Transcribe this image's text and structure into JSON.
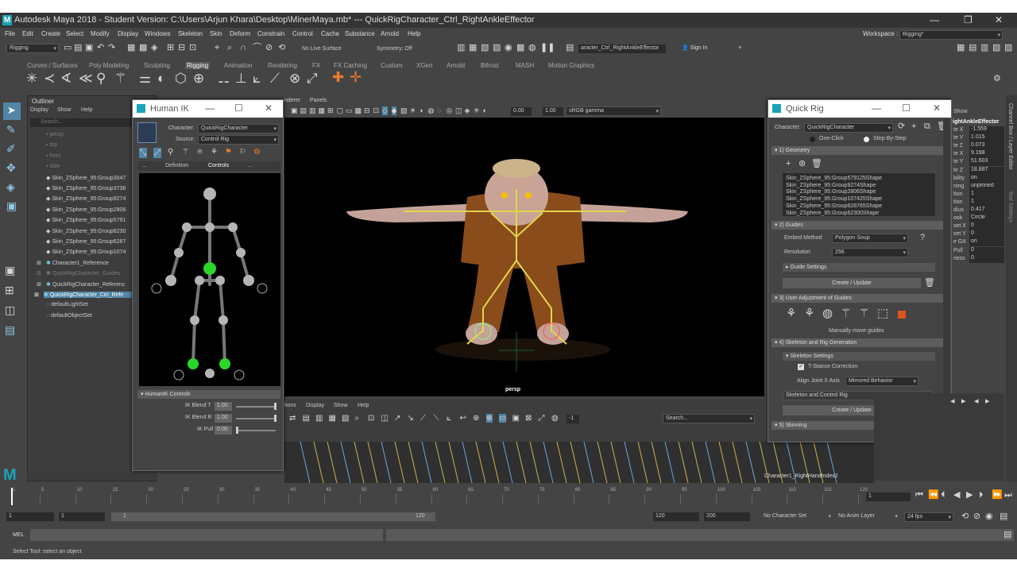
{
  "title": "Autodesk Maya 2018 - Student Version: C:\\Users\\Arjun Khara\\Desktop\\MinerMaya.mb*  ---  QuickRigCharacter_Ctrl_RightAnkleEffector",
  "menu": [
    "File",
    "Edit",
    "Create",
    "Select",
    "Modify",
    "Display",
    "Windows",
    "Skeleton",
    "Skin",
    "Deform",
    "Constrain",
    "Control",
    "Cache",
    "Substance",
    "Arnold",
    "Help"
  ],
  "workspace_label": "Workspace :",
  "workspace_value": "Rigging*",
  "mode_select": "Rigging",
  "live_surface": "No Live Surface",
  "symmetry": "Symmetry: Off",
  "selected_field": "aracter_Ctrl_RightAnkleEffector",
  "sign_in": "Sign In",
  "shelf_tabs": [
    "Curves / Surfaces",
    "Poly Modeling",
    "Sculpting",
    "Rigging",
    "Animation",
    "Rendering",
    "FX",
    "FX Caching",
    "Custom",
    "XGen",
    "Arnold",
    "Bifrost",
    "MASH",
    "Motion Graphics"
  ],
  "outliner": {
    "title": "Outliner",
    "menu": [
      "Display",
      "Show",
      "Help"
    ],
    "search_placeholder": "Search...",
    "items": [
      "persp",
      "top",
      "front",
      "side",
      "Skin_ZSphere_95:Group3047",
      "Skin_ZSphere_95:Group3736",
      "Skin_ZSphere_95:Group9274",
      "Skin_ZSphere_95:Group2806",
      "Skin_ZSphere_95:Group5791",
      "Skin_ZSphere_95:Group6230",
      "Skin_ZSphere_95:Group6287",
      "Skin_ZSphere_95:Group1074",
      "Character1_Reference",
      "QuickRigCharacter_Guides",
      "QuickRigCharacter_Referenc",
      "QuickRigCharacter_Ctrl_Refe",
      "defaultLightSet",
      "defaultObjectSet"
    ]
  },
  "humanik": {
    "title": "Human IK",
    "character_label": "Character:",
    "character": "QuickRigCharacter",
    "source_label": "Source:",
    "source": "Control Rig",
    "tabs": [
      "Definition",
      "Controls"
    ],
    "tab_dots": "...",
    "controls_header": "HumanIK Controls",
    "blend_t_label": "IK Blend T",
    "blend_t": "1.00",
    "blend_r_label": "IK Blend R",
    "blend_r": "1.00",
    "pull_label": "IK Pull",
    "pull": "0.00"
  },
  "viewport": {
    "menu_tail": "nderer",
    "panels": "Panels",
    "field1": "0.00",
    "field2": "1.00",
    "color_space": "sRGB gamma",
    "camera": "persp"
  },
  "graph_menu": [
    "tions",
    "Display",
    "Show",
    "Help"
  ],
  "graph_search": "Search...",
  "graph_field": "-1",
  "quickrig": {
    "title": "Quick Rig",
    "character_label": "Character:",
    "character": "QuickRigCharacter",
    "one_click": "One-Click",
    "step_by_step": "Step-By-Step",
    "geometry": "1) Geometry",
    "geo_list": [
      "Skin_ZSphere_95:Group579125Shape",
      "Skin_ZSphere_95:Group9274Shape",
      "Skin_ZSphere_95:Group2806Shape",
      "Skin_ZSphere_95:Group107425Shape",
      "Skin_ZSphere_95:Group628765Shape",
      "Skin_ZSphere_95:Group62300Shape"
    ],
    "guides": "2) Guides",
    "embed_label": "Embed Method",
    "embed": "Polygon Soup",
    "resolution_label": "Resolution",
    "resolution": "256",
    "guide_settings": "Guide Settings",
    "create_update": "Create / Update",
    "user_adjust": "3) User Adjustment of Guides",
    "manually": "Manually move guides",
    "skeleton_rig": "4) Skeleton and Rig Generation",
    "skeleton_settings": "Skeleton Settings",
    "tstance": "T-Stance Correction",
    "align_label": "Align Joint X Axis",
    "align": "Mirrored Behavior",
    "skel_control": "Skeleton and Control Rig",
    "skinning": "5) Skinning"
  },
  "channel_box": {
    "show": "Show",
    "node": "ightAnkleEffector",
    "rows": [
      [
        "te X",
        "-1.559"
      ],
      [
        "te Y",
        "1.015"
      ],
      [
        "te Z",
        "0.073"
      ],
      [
        "te X",
        "9.198"
      ],
      [
        "te Y",
        "51.603"
      ],
      [
        "te Z",
        "18.887"
      ],
      [
        "bility",
        "on"
      ],
      [
        "ning",
        "unpinned"
      ],
      [
        "tion",
        "1"
      ],
      [
        "tion",
        "1"
      ],
      [
        "dius",
        "0.417"
      ],
      [
        "ook",
        "Circle"
      ],
      [
        "set X",
        "0"
      ],
      [
        "set Y",
        "0"
      ],
      [
        "e GX",
        "on"
      ],
      [
        "Pull",
        "0"
      ],
      [
        "ness",
        "0"
      ]
    ],
    "side_tab1": "Channel Box / Layer Editor",
    "side_tab2": "Tool Settings"
  },
  "timeline": {
    "ticks": [
      "1",
      "5",
      "10",
      "15",
      "20",
      "25",
      "30",
      "35",
      "40",
      "45",
      "50",
      "55",
      "60",
      "65",
      "70",
      "75",
      "80",
      "85",
      "90",
      "95",
      "100",
      "105",
      "110",
      "115",
      "120"
    ],
    "current": "1",
    "track_label": "Character1_RightHandIndex2"
  },
  "range": {
    "start": "1",
    "start2": "1",
    "slider_start": "1",
    "slider_end": "120",
    "end1": "120",
    "end2": "200",
    "char_set": "No Character Set",
    "anim_layer": "No Anim Layer",
    "fps": "24 fps"
  },
  "mel_label": "MEL",
  "help_line": "Select Tool: select an object"
}
